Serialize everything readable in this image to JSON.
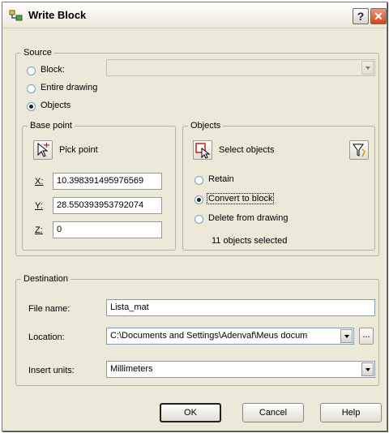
{
  "title": "Write Block",
  "titlebar": {
    "help_label": "?",
    "close_label": "✕"
  },
  "source": {
    "legend": "Source",
    "block_label": "Block:",
    "entire_label": "Entire drawing",
    "objects_label": "Objects",
    "selected": "Objects",
    "block_value": ""
  },
  "base_point": {
    "legend": "Base point",
    "pick_label": "Pick point",
    "x_label": "X:",
    "x_value": "10.398391495976569",
    "y_label": "Y:",
    "y_value": "28.550393953792074",
    "z_label": "Z:",
    "z_value": "0"
  },
  "objects": {
    "legend": "Objects",
    "select_label": "Select objects",
    "retain_label": "Retain",
    "convert_label": "Convert to block",
    "delete_label": "Delete from drawing",
    "selected_mode": "Convert to block",
    "count_text": "11 objects selected"
  },
  "destination": {
    "legend": "Destination",
    "file_label": "File name:",
    "file_value": "Lista_mat",
    "location_label": "Location:",
    "location_value": "C:\\Documents and Settings\\Adenvaf\\Meus docum",
    "browse_label": "...",
    "units_label": "Insert units:",
    "units_value": "Millimeters"
  },
  "buttons": {
    "ok": "OK",
    "cancel": "Cancel",
    "help": "Help"
  }
}
